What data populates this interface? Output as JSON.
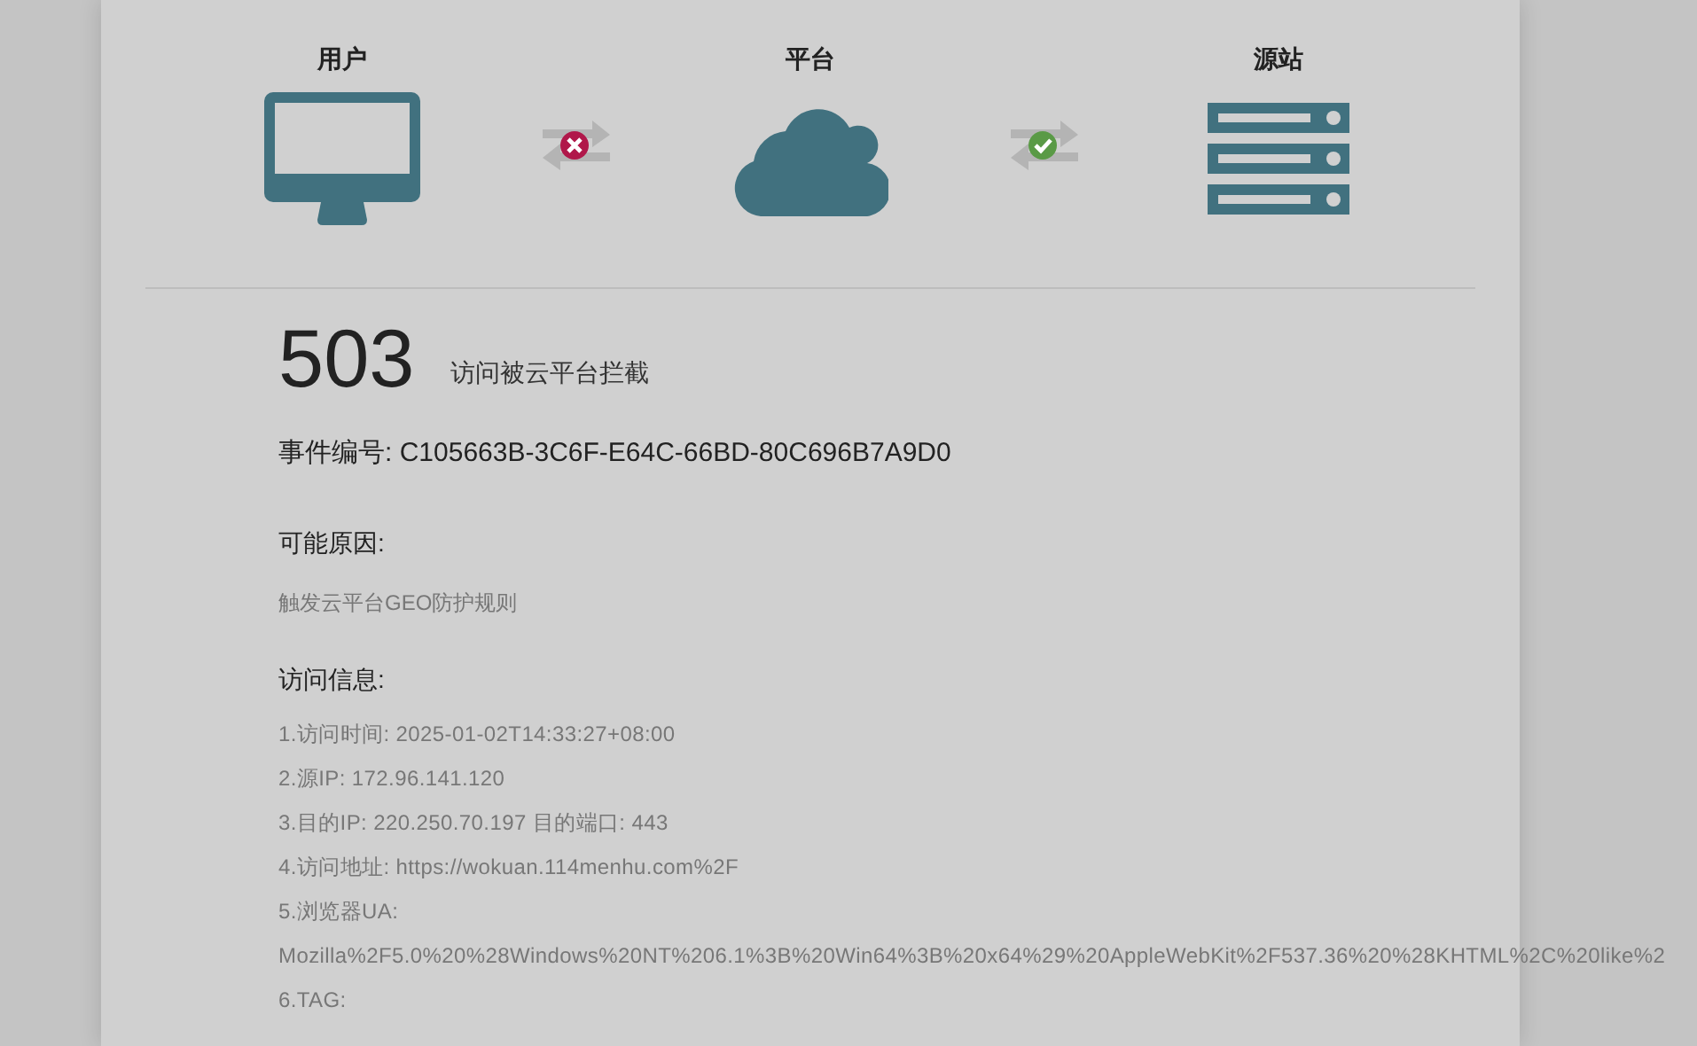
{
  "nodes": [
    {
      "kind": "monitor",
      "label": "用户"
    },
    {
      "kind": "cloud",
      "label": "平台"
    },
    {
      "kind": "server",
      "label": "源站"
    }
  ],
  "links": [
    {
      "kind": "blocked"
    },
    {
      "kind": "ok"
    }
  ],
  "error": {
    "code": "503",
    "message": "访问被云平台拦截"
  },
  "event_id": "事件编号: C105663B-3C6F-E64C-66BD-80C696B7A9D0",
  "reasons": {
    "heading": "可能原因:",
    "items": [
      "触发云平台GEO防护规则"
    ]
  },
  "access_info": {
    "heading": "访问信息:",
    "items": [
      "1.访问时间: 2025-01-02T14:33:27+08:00",
      "2.源IP: 172.96.141.120",
      "3.目的IP: 220.250.70.197 目的端口: 443",
      "4.访问地址: https://wokuan.114menhu.com%2F",
      "5.浏览器UA:",
      "Mozilla%2F5.0%20%28Windows%20NT%206.1%3B%20Win64%3B%20x64%29%20AppleWebKit%2F537.36%20%28KHTML%2C%20like%2",
      "6.TAG:"
    ]
  }
}
